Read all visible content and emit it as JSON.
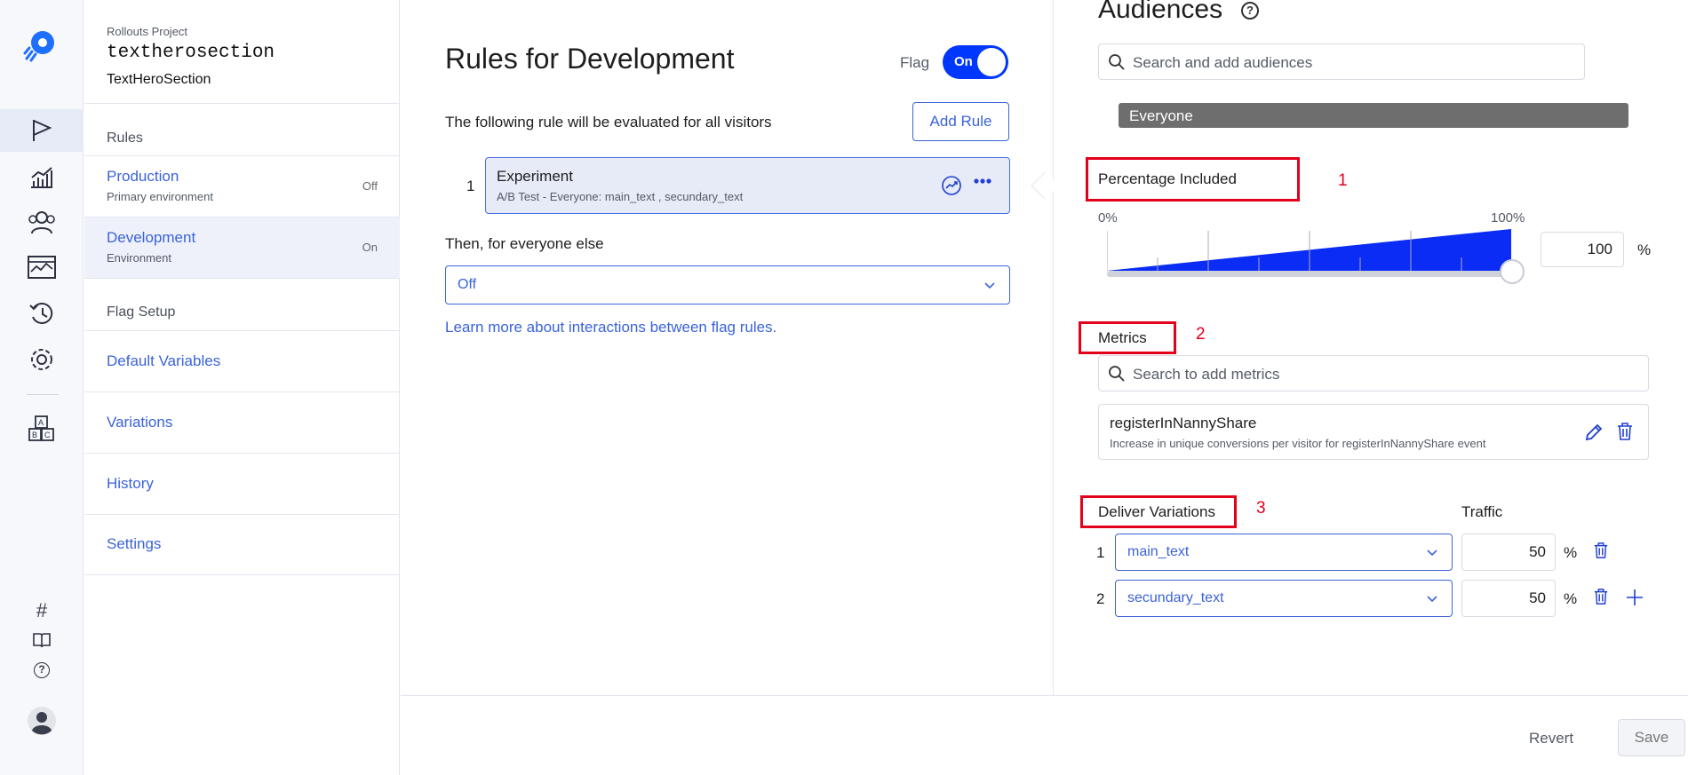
{
  "rail": {
    "icons": [
      "rocket-logo-icon",
      "flag-icon",
      "chart-icon",
      "audiences-icon",
      "events-icon",
      "history-icon",
      "settings-icon",
      "abc-blocks-icon",
      "hash-icon",
      "book-icon",
      "help-icon",
      "user-avatar-icon"
    ],
    "hash_glyph": "#",
    "help_glyph": "?"
  },
  "sidebar": {
    "project_label": "Rollouts Project",
    "project_key": "textherosection",
    "project_name": "TextHeroSection",
    "rules_title": "Rules",
    "environments": [
      {
        "name": "Production",
        "sub": "Primary environment",
        "state": "Off"
      },
      {
        "name": "Development",
        "sub": "Environment",
        "state": "On"
      }
    ],
    "flag_setup_title": "Flag Setup",
    "links": [
      "Default Variables",
      "Variations",
      "History",
      "Settings"
    ]
  },
  "main": {
    "title": "Rules for Development",
    "flag_label": "Flag",
    "toggle_label": "On",
    "rule_desc": "The following rule will be evaluated for all visitors",
    "add_rule": "Add Rule",
    "rule": {
      "num": "1",
      "name": "Experiment",
      "sub": "A/B Test - Everyone: main_text , secundary_text"
    },
    "else_label": "Then, for everyone else",
    "else_value": "Off",
    "learn_link": "Learn more about interactions between flag rules."
  },
  "right": {
    "audiences_title": "Audiences",
    "help_glyph": "?",
    "audience_search_placeholder": "Search and add audiences",
    "audience_chip": "Everyone",
    "percentage": {
      "label": "Percentage Included",
      "marker": "1",
      "min_label": "0%",
      "max_label": "100%",
      "value": "100",
      "unit": "%",
      "fill_fraction": 1.0
    },
    "metrics": {
      "label": "Metrics",
      "marker": "2",
      "search_placeholder": "Search to add metrics",
      "item_name": "registerInNannyShare",
      "item_sub": "Increase in unique conversions per visitor for registerInNannyShare event"
    },
    "variations": {
      "label": "Deliver Variations",
      "marker": "3",
      "traffic_label": "Traffic",
      "rows": [
        {
          "num": "1",
          "name": "main_text",
          "traffic": "50",
          "unit": "%"
        },
        {
          "num": "2",
          "name": "secundary_text",
          "traffic": "50",
          "unit": "%"
        }
      ]
    }
  },
  "footer": {
    "revert": "Revert",
    "save": "Save"
  },
  "colors": {
    "accent": "#3b63d9",
    "toggle": "#0037ff",
    "highlight": "#e3001b",
    "chip": "#6e6e6e"
  }
}
